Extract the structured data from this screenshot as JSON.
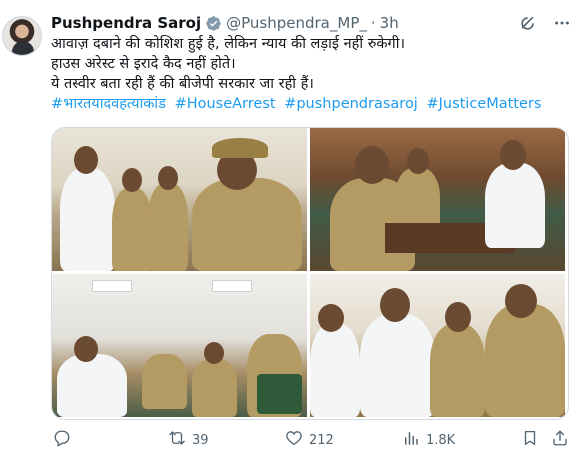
{
  "tweet": {
    "display_name": "Pushpendra Saroj",
    "handle": "@Pushpendra_MP_",
    "separator": "·",
    "time": "3h",
    "lines": [
      "आवाज़ दबाने की कोशिश हुई है, लेकिन न्याय की लड़ाई नहीं रुकेगी।",
      "हाउस अरेस्ट से इरादे कैद नहीं होते।",
      "ये तस्वीर बता रही हैं की बीजेपी सरकार जा रही हैं।"
    ],
    "hashtags": [
      "#भारतयादवहत्याकांड",
      "#HouseArrest",
      "#pushpendrasaroj",
      "#JusticeMatters"
    ]
  },
  "actions": {
    "reply_count": "",
    "retweet_count": "39",
    "like_count": "212",
    "views_count": "1.8K"
  },
  "icons": {
    "verified": "verified-badge-icon",
    "grok": "grok-icon",
    "more": "more-icon",
    "reply": "reply-icon",
    "retweet": "retweet-icon",
    "like": "heart-icon",
    "views": "views-icon",
    "bookmark": "bookmark-icon",
    "share": "share-icon"
  },
  "colors": {
    "text": "#0f1419",
    "secondary": "#536471",
    "link": "#1d9bf0"
  }
}
